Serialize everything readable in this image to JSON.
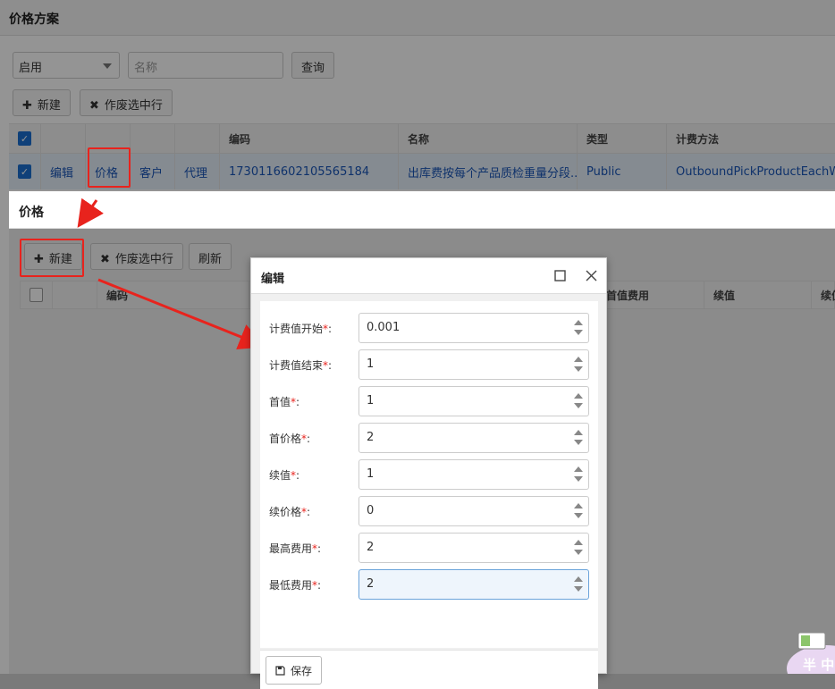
{
  "base": {
    "title": "价格方案",
    "status_filter": "启用",
    "name_placeholder": "名称",
    "query_label": "查询",
    "new_label": "新建",
    "void_label": "作废选中行",
    "columns": [
      "编码",
      "名称",
      "类型",
      "计费方法"
    ],
    "row": {
      "actions": [
        "编辑",
        "价格",
        "客户",
        "代理"
      ],
      "code": "1730116602105565184",
      "name": "出库费按每个产品质检重量分段...",
      "type": "Public",
      "method": "OutboundPickProductEachW..."
    }
  },
  "price_window": {
    "title": "价格",
    "new_label": "新建",
    "void_label": "作废选中行",
    "refresh_label": "刷新",
    "columns": [
      "编码",
      "首值费用",
      "续值",
      "续值"
    ]
  },
  "edit_dialog": {
    "title": "编辑",
    "fields": [
      {
        "label": "计费值开始",
        "value": "0.001"
      },
      {
        "label": "计费值结束",
        "value": "1"
      },
      {
        "label": "首值",
        "value": "1"
      },
      {
        "label": "首价格",
        "value": "2"
      },
      {
        "label": "续值",
        "value": "1"
      },
      {
        "label": "续价格",
        "value": "0"
      },
      {
        "label": "最高费用",
        "value": "2"
      },
      {
        "label": "最低费用",
        "value": "2"
      }
    ],
    "required_mark": "*",
    "label_suffix": ":",
    "save_label": "保存"
  },
  "widget": {
    "text": "半 中"
  },
  "icons": {
    "plus": "plus-icon",
    "close": "close-icon",
    "maximize": "maximize-icon",
    "save": "save-icon",
    "dropdown": "caret-down-icon",
    "check": "check-icon"
  },
  "colors": {
    "accent": "#1a6fd0",
    "highlight": "#e8231d",
    "link": "#1a56b8"
  }
}
